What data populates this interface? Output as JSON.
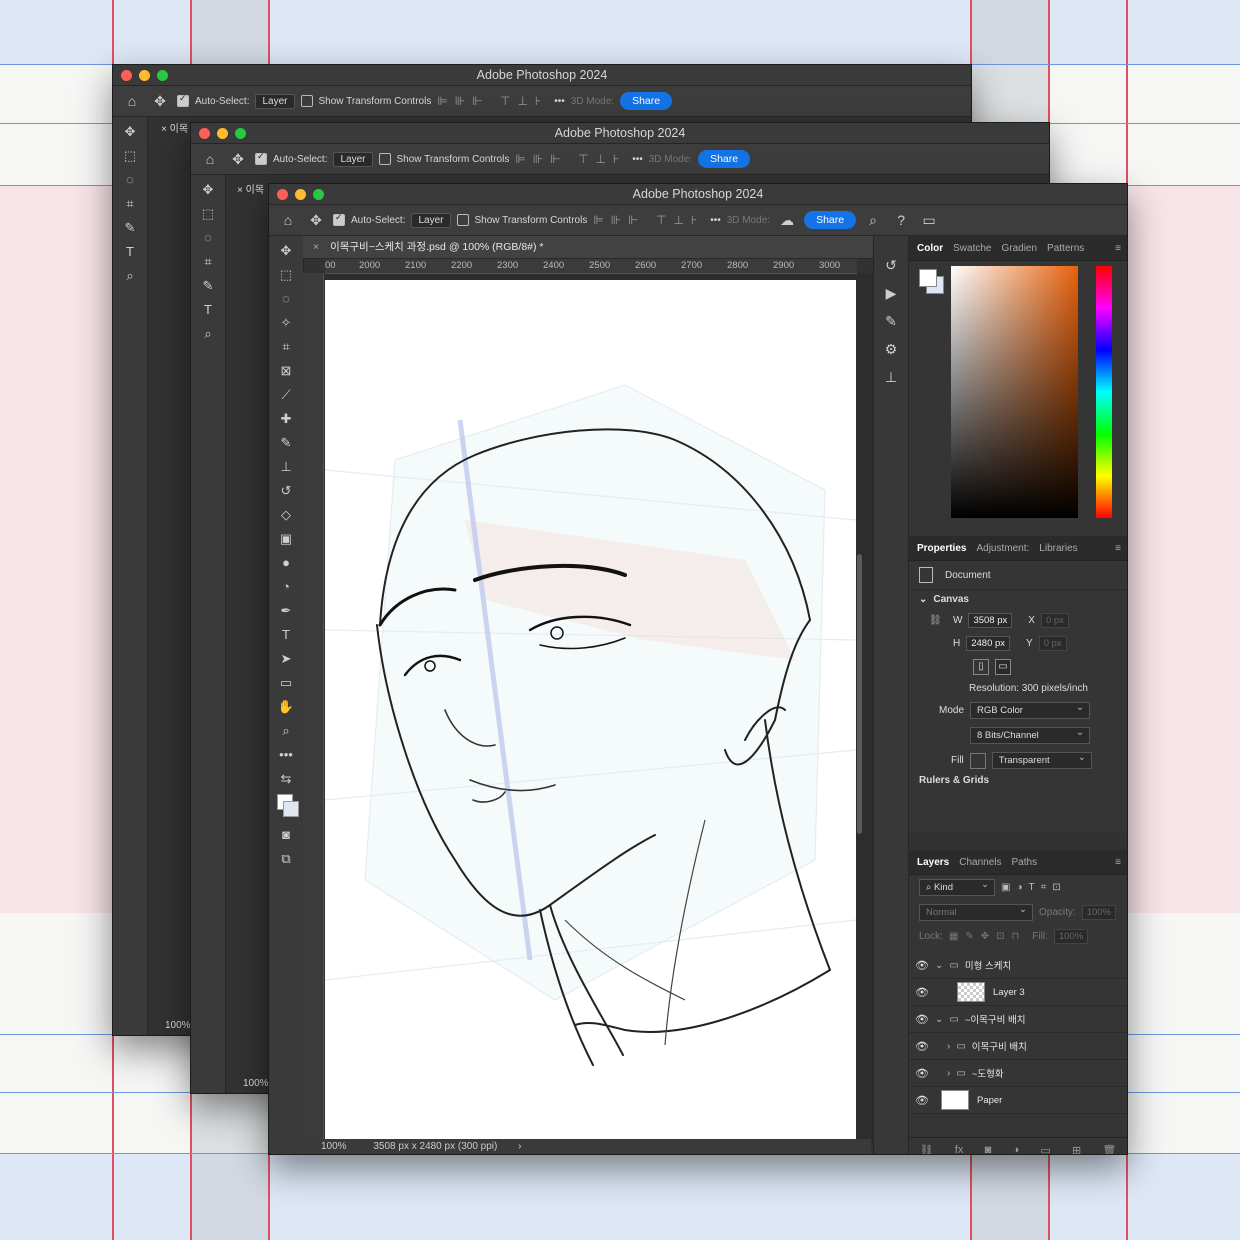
{
  "app": {
    "window_title": "Adobe Photoshop 2024"
  },
  "options_bar": {
    "auto_select_label": "Auto-Select:",
    "auto_select_value": "Layer",
    "show_transform_label": "Show Transform Controls",
    "three_d_label": "3D Mode:",
    "share_label": "Share",
    "more": "•••"
  },
  "document": {
    "tab_title": "이목구비~스케치 과정.psd @ 100% (RGB/8#) *",
    "back_tab_title": "이목",
    "ruler_ticks": [
      "00",
      "2000",
      "2100",
      "2200",
      "2300",
      "2400",
      "2500",
      "2600",
      "2700",
      "2800",
      "2900",
      "3000"
    ],
    "zoom": "100%",
    "doc_info": "3508 px x 2480 px (300 ppi)",
    "nav_chevron": "›"
  },
  "color_panel": {
    "tabs": [
      "Color",
      "Swatche",
      "Gradien",
      "Patterns"
    ],
    "active_tab": "Color"
  },
  "properties_panel": {
    "tabs": [
      "Properties",
      "Adjustment:",
      "Libraries"
    ],
    "type_label": "Document",
    "canvas_heading": "Canvas",
    "w_label": "W",
    "w_value": "3508 px",
    "h_label": "H",
    "h_value": "2480 px",
    "x_label": "X",
    "x_placeholder": "0 px",
    "y_label": "Y",
    "y_placeholder": "0 px",
    "resolution": "Resolution: 300 pixels/inch",
    "mode_label": "Mode",
    "mode_value": "RGB Color",
    "bits_value": "8 Bits/Channel",
    "fill_label": "Fill",
    "fill_value": "Transparent",
    "next_section": "Rulers & Grids"
  },
  "layers_panel": {
    "tabs": [
      "Layers",
      "Channels",
      "Paths"
    ],
    "kind_label": "Kind",
    "blend_mode": "Normal",
    "opacity_label": "Opacity:",
    "opacity_value": "100%",
    "lock_label": "Lock:",
    "fill_label": "Fill:",
    "fill_value": "100%",
    "layers": [
      {
        "name": "미형 스케치",
        "type": "group",
        "indent": 0,
        "expanded": true
      },
      {
        "name": "Layer 3",
        "type": "layer",
        "indent": 1
      },
      {
        "name": "~이목구비 배치",
        "type": "group",
        "indent": 0,
        "expanded": true
      },
      {
        "name": "이목구비 배치",
        "type": "group",
        "indent": 1,
        "expanded": false
      },
      {
        "name": "~도형화",
        "type": "group",
        "indent": 1,
        "expanded": false
      },
      {
        "name": "Paper",
        "type": "layer",
        "indent": 0
      }
    ]
  },
  "status": {
    "back_zoom": "100%",
    "mid_zoom": "100%"
  },
  "colors": {
    "accent": "#1473e6",
    "panel_bg": "#323232",
    "grid_red": "#e05060",
    "grid_blue": "#6f95e0"
  }
}
